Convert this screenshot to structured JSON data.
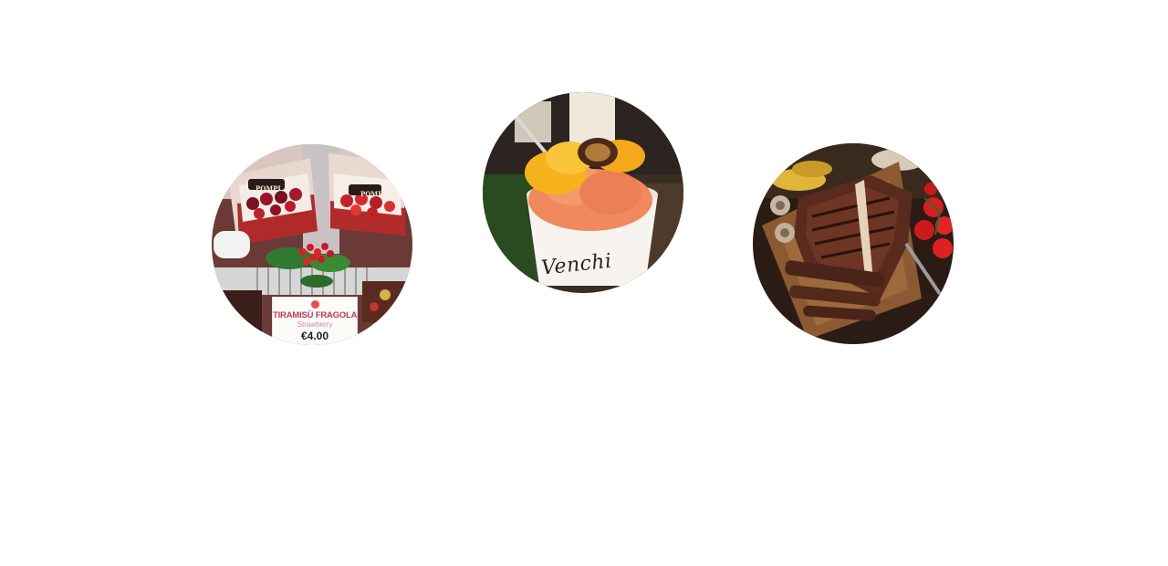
{
  "images": [
    {
      "name": "tiramisu-display",
      "price_card": {
        "name": "TIRAMISÙ FRAGOLA",
        "subtitle": "Strawberry",
        "price": "€4.00"
      },
      "box_logo": "POMPI"
    },
    {
      "name": "gelato-cup",
      "cup_brand": "Venchi"
    },
    {
      "name": "grilled-steak"
    }
  ],
  "colors": {
    "background": "#ffffff",
    "price_name": "#c23a5a",
    "strawberry": "#c81e2b",
    "gelato_orange": "#f08a5d",
    "mango": "#f6b21c",
    "steak": "#5a2a1e"
  }
}
